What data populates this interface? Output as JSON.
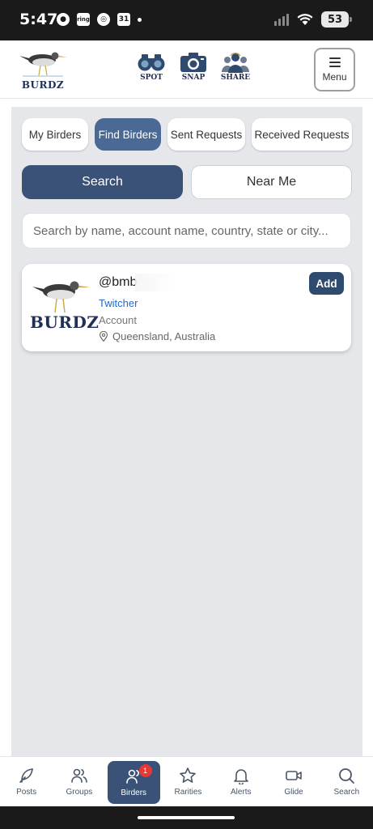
{
  "status_bar": {
    "time": "5:47",
    "ring_label": "ring",
    "calendar_day": "31",
    "battery": "53"
  },
  "header": {
    "logo_text": "BURDZ",
    "nav": [
      {
        "label": "SPOT",
        "icon": "binoculars-icon"
      },
      {
        "label": "SNAP",
        "icon": "camera-icon"
      },
      {
        "label": "SHARE",
        "icon": "people-icon"
      }
    ],
    "menu_label": "Menu"
  },
  "tabs": [
    {
      "label": "My Birders",
      "active": false
    },
    {
      "label": "Find Birders",
      "active": true
    },
    {
      "label": "Sent Requests",
      "active": false
    },
    {
      "label": "Received Requests",
      "active": false
    }
  ],
  "search_mode": {
    "search_label": "Search",
    "near_me_label": "Near Me"
  },
  "search": {
    "placeholder": "Search by name, account name, country, state or city..."
  },
  "results": [
    {
      "avatar_text": "BURDZ",
      "handle": "@bmb",
      "level": "Twitcher",
      "account": "Account",
      "location": "Queensland, Australia",
      "action": "Add"
    }
  ],
  "bottom_nav": [
    {
      "label": "Posts",
      "icon": "feather-icon"
    },
    {
      "label": "Groups",
      "icon": "groups-icon"
    },
    {
      "label": "Birders",
      "icon": "person-icon",
      "active": true,
      "badge": "1"
    },
    {
      "label": "Rarities",
      "icon": "star-icon"
    },
    {
      "label": "Alerts",
      "icon": "bell-icon"
    },
    {
      "label": "Glide",
      "icon": "video-icon"
    },
    {
      "label": "Search",
      "icon": "search-icon"
    }
  ],
  "colors": {
    "primary": "#3a5278",
    "active_tab": "#4a6a95",
    "link": "#2469c9",
    "badge": "#e53935",
    "panel": "#e6e7eb"
  }
}
